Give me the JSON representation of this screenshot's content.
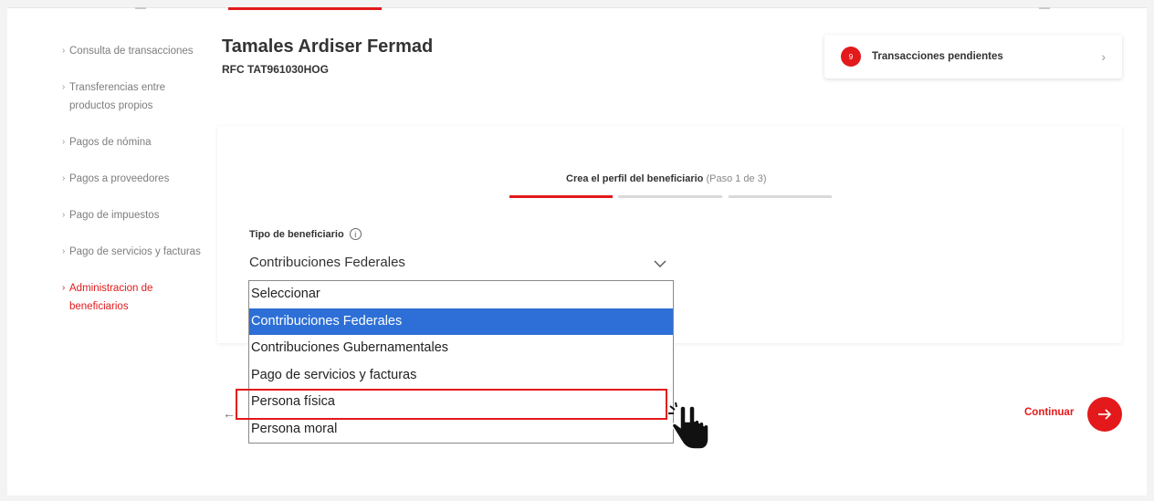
{
  "sidebar": {
    "items": [
      {
        "label": "Consulta de transacciones",
        "active": false
      },
      {
        "label": "Transferencias entre productos propios",
        "active": false
      },
      {
        "label": "Pagos de nómina",
        "active": false
      },
      {
        "label": "Pagos a proveedores",
        "active": false
      },
      {
        "label": "Pago de impuestos",
        "active": false
      },
      {
        "label": "Pago de servicios y facturas",
        "active": false
      },
      {
        "label": "Administracion de beneficiarios",
        "active": true
      }
    ]
  },
  "header": {
    "name": "Tamales Ardiser Fermad",
    "rfc": "RFC TAT961030HOG"
  },
  "pending": {
    "count": "9",
    "label": "Transacciones pendientes"
  },
  "form": {
    "step_title": "Crea el perfil del beneficiario",
    "step_sub": "(Paso 1 de 3)",
    "current_step": 1,
    "total_steps": 3,
    "field_label": "Tipo de beneficiario",
    "select_value": "Contribuciones Federales"
  },
  "dropdown": {
    "options": [
      "Seleccionar",
      "Contribuciones Federales",
      "Contribuciones Gubernamentales",
      "Pago de servicios y facturas",
      "Persona física",
      "Persona moral"
    ],
    "selected_index": 1,
    "highlighted_index": 4
  },
  "actions": {
    "continue_label": "Continuar"
  },
  "colors": {
    "accent": "#e3191b",
    "selection": "#2d6fd6"
  }
}
